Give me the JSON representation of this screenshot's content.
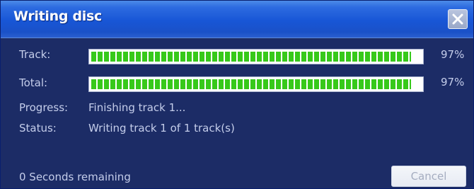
{
  "window": {
    "title": "Writing disc",
    "close_icon": "close-icon"
  },
  "rows": {
    "track": {
      "label": "Track:",
      "percent_label": "97%",
      "progress_fraction": 0.97
    },
    "total": {
      "label": "Total:",
      "percent_label": "97%",
      "progress_fraction": 0.97
    },
    "progress": {
      "label": "Progress:",
      "value": "Finishing track 1..."
    },
    "status": {
      "label": "Status:",
      "value": "Writing track 1 of 1 track(s)"
    }
  },
  "footer": {
    "remaining": "0 Seconds remaining",
    "cancel_label": "Cancel",
    "cancel_enabled": false
  },
  "colors": {
    "window_background": "#1c2c66",
    "titlebar": "#1856d6",
    "progress_green": "#37c91a",
    "label_text": "#c4cdea"
  }
}
